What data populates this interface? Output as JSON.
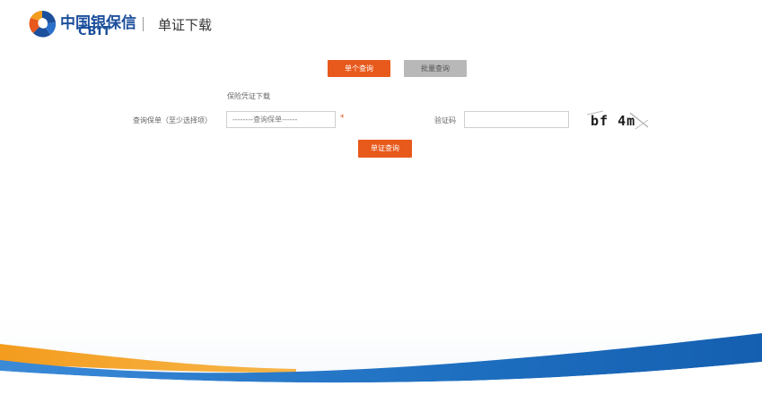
{
  "header": {
    "logo_cn": "中国银保信",
    "logo_en": "CBIT",
    "title": "单证下载"
  },
  "tabs": [
    {
      "label": "单个查询",
      "active": true
    },
    {
      "label": "批量查询",
      "active": false
    }
  ],
  "form": {
    "note": "保险凭证下载",
    "policy_label": "查询保单（至少选择项）",
    "policy_placeholder": "--------查询保单------",
    "required_mark": "*",
    "captcha_label": "验证码",
    "captcha_value": "",
    "captcha_text": "bf 4m",
    "submit_label": "单证查询"
  },
  "colors": {
    "brand_blue": "#1c4f9c",
    "accent_orange": "#e8591c",
    "inactive_gray": "#b8b8b8",
    "wave_blue": "#1e6fc0"
  }
}
